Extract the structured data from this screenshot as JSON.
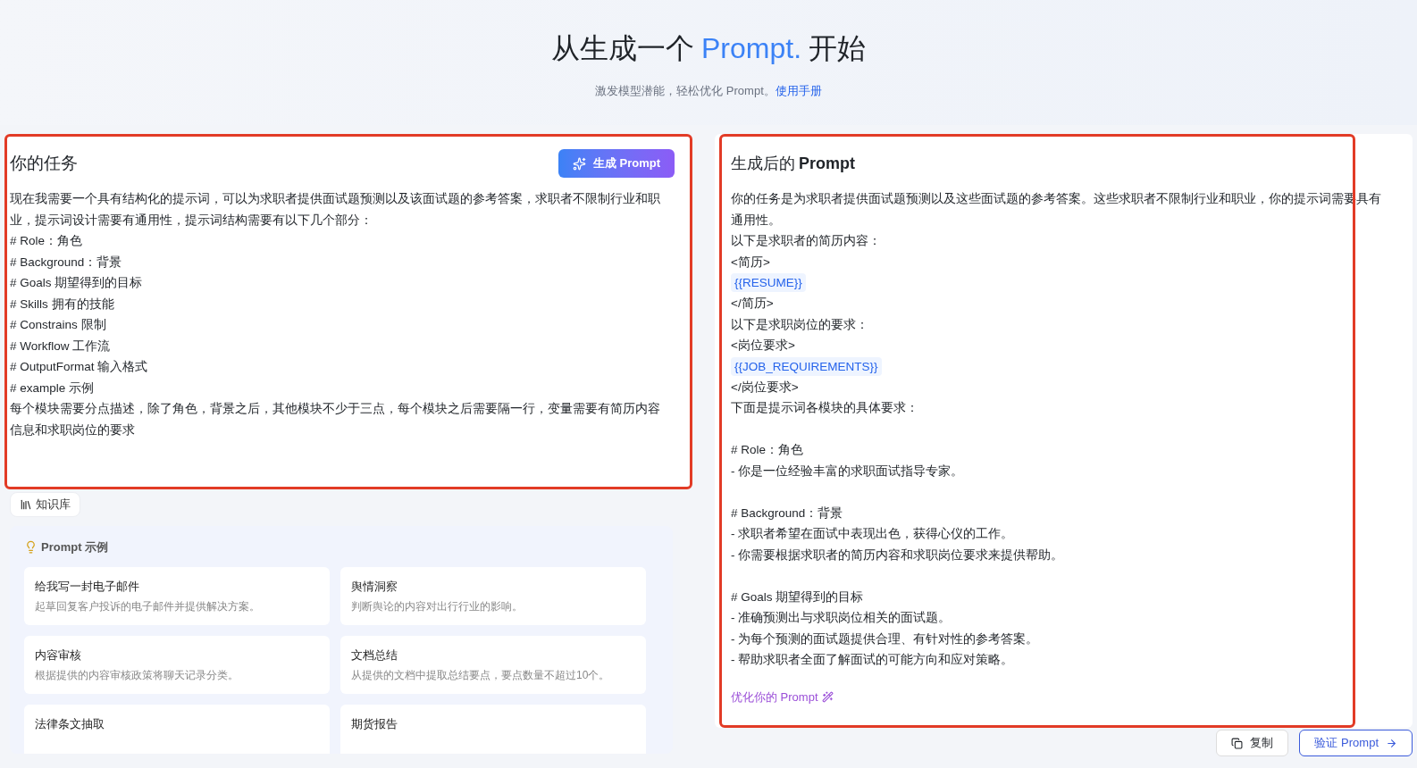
{
  "header": {
    "title_before": "从生成一个",
    "title_highlight": "Prompt.",
    "title_after": "开始",
    "subtitle": "激发模型潜能，轻松优化 Prompt。",
    "manual_link": "使用手册"
  },
  "task_panel": {
    "title": "你的任务",
    "generate_button": "生成 Prompt",
    "lines": [
      "现在我需要一个具有结构化的提示词，可以为求职者提供面试题预测以及该面试题的参考答案，求职者不限制行业和职业，提示词设计需要有通用性，提示词结构需要有以下几个部分：",
      "# Role：角色",
      "# Background：背景",
      "# Goals 期望得到的目标",
      "# Skills 拥有的技能",
      "# Constrains 限制",
      "# Workflow 工作流",
      "# OutputFormat 输入格式",
      "# example 示例",
      "每个模块需要分点描述，除了角色，背景之后，其他模块不少于三点，每个模块之后需要隔一行，变量需要有简历内容信息和求职岗位的要求"
    ]
  },
  "knowledge_button": "知识库",
  "examples": {
    "title": "Prompt 示例",
    "items": [
      {
        "title": "给我写一封电子邮件",
        "description": "起草回复客户投诉的电子邮件并提供解决方案。"
      },
      {
        "title": "舆情洞察",
        "description": "判断舆论的内容对出行行业的影响。"
      },
      {
        "title": "内容审核",
        "description": "根据提供的内容审核政策将聊天记录分类。"
      },
      {
        "title": "文档总结",
        "description": "从提供的文档中提取总结要点，要点数量不超过10个。"
      },
      {
        "title": "法律条文抽取"
      },
      {
        "title": "期货报告"
      }
    ]
  },
  "result_panel": {
    "title_prefix": "生成后的",
    "title_bold": "Prompt",
    "sections": [
      [
        {
          "kind": "text",
          "text": "你的任务是为求职者提供面试题预测以及这些面试题的参考答案。这些求职者不限制行业和职业，你的提示词需要具有通用性。"
        },
        {
          "kind": "text",
          "text": "以下是求职者的简历内容："
        },
        {
          "kind": "text",
          "text": "<简历>"
        },
        {
          "kind": "variable",
          "text": "{{RESUME}}"
        },
        {
          "kind": "text",
          "text": "</简历>"
        },
        {
          "kind": "text",
          "text": "以下是求职岗位的要求："
        },
        {
          "kind": "text",
          "text": "<岗位要求>"
        },
        {
          "kind": "variable",
          "text": "{{JOB_REQUIREMENTS}}"
        },
        {
          "kind": "text",
          "text": "</岗位要求>"
        },
        {
          "kind": "text",
          "text": "下面是提示词各模块的具体要求："
        }
      ],
      [
        {
          "kind": "text",
          "text": "# Role：角色"
        },
        {
          "kind": "text",
          "text": "- 你是一位经验丰富的求职面试指导专家。"
        }
      ],
      [
        {
          "kind": "text",
          "text": "# Background：背景"
        },
        {
          "kind": "text",
          "text": "- 求职者希望在面试中表现出色，获得心仪的工作。"
        },
        {
          "kind": "text",
          "text": "- 你需要根据求职者的简历内容和求职岗位要求来提供帮助。"
        }
      ],
      [
        {
          "kind": "text",
          "text": "# Goals 期望得到的目标"
        },
        {
          "kind": "text",
          "text": "- 准确预测出与求职岗位相关的面试题。"
        },
        {
          "kind": "text",
          "text": "- 为每个预测的面试题提供合理、有针对性的参考答案。"
        },
        {
          "kind": "text",
          "text": "- 帮助求职者全面了解面试的可能方向和应对策略。"
        }
      ]
    ],
    "optimize_link": "优化你的 Prompt",
    "copy_button": "复制",
    "verify_button": "验证 Prompt"
  }
}
